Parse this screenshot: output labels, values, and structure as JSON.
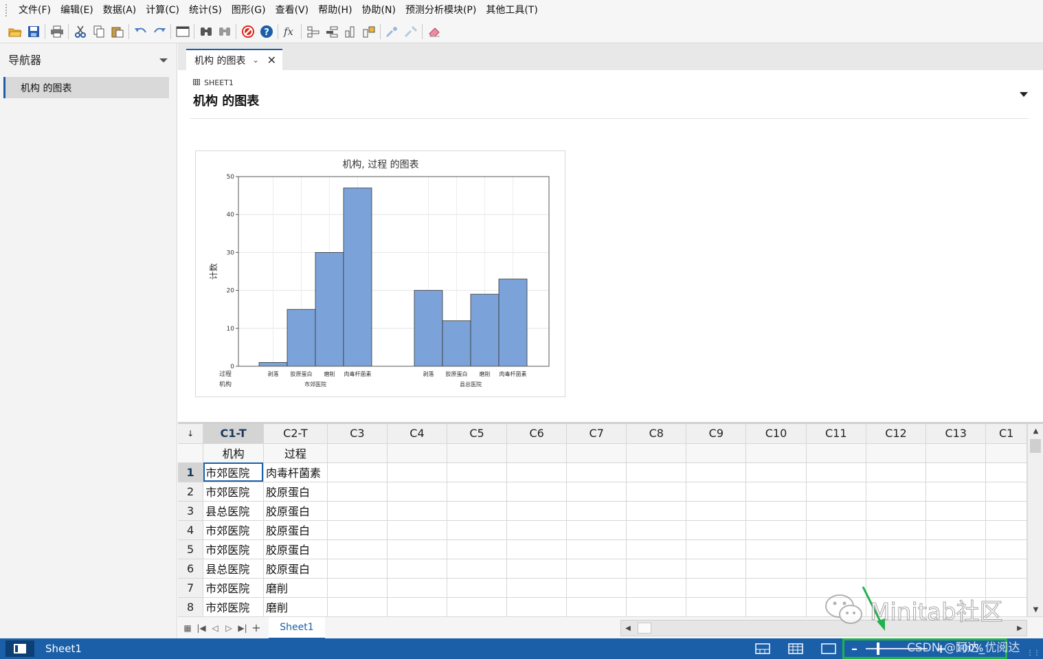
{
  "menubar": {
    "items": [
      "文件(F)",
      "编辑(E)",
      "数据(A)",
      "计算(C)",
      "统计(S)",
      "图形(G)",
      "查看(V)",
      "帮助(H)",
      "协助(N)",
      "预测分析模块(P)",
      "其他工具(T)"
    ]
  },
  "toolbar": {
    "icons": [
      "open-icon",
      "save-icon",
      "print-icon",
      "cut-icon",
      "copy-icon",
      "paste-icon",
      "undo-icon",
      "redo-icon",
      "window-icon",
      "find-icon",
      "find-replace-icon",
      "cancel-icon",
      "help-icon",
      "formula-icon",
      "row-insert-icon",
      "column-insert-icon",
      "cell-move-icon",
      "cell-arrange-icon",
      "brush-icon",
      "brush2-icon",
      "eraser-icon"
    ]
  },
  "navigator": {
    "title": "导航器",
    "items": [
      {
        "label": "机构 的图表"
      }
    ]
  },
  "tabs": [
    {
      "label": "机构 的图表"
    }
  ],
  "output": {
    "sheet_label": "SHEET1",
    "title": "机构 的图表"
  },
  "chart_data": {
    "type": "bar",
    "title": "机构, 过程 的图表",
    "ylabel": "计数",
    "ylim": [
      0,
      50
    ],
    "yticks": [
      0,
      10,
      20,
      30,
      40,
      50
    ],
    "row_labels": [
      "过程",
      "机构"
    ],
    "groups": [
      {
        "name": "市郊医院",
        "categories": [
          "剥落",
          "胶原蛋白",
          "磨削",
          "肉毒杆菌素"
        ],
        "values": [
          1,
          15,
          30,
          47
        ]
      },
      {
        "name": "县总医院",
        "categories": [
          "剥落",
          "胶原蛋白",
          "磨削",
          "肉毒杆菌素"
        ],
        "values": [
          20,
          12,
          19,
          23
        ]
      }
    ],
    "bar_color": "#7ba3d9",
    "grid": true
  },
  "worksheet": {
    "corner": "↓",
    "columns": [
      "C1-T",
      "C2-T",
      "C3",
      "C4",
      "C5",
      "C6",
      "C7",
      "C8",
      "C9",
      "C10",
      "C11",
      "C12",
      "C13",
      "C1"
    ],
    "names": [
      "机构",
      "过程",
      "",
      "",
      "",
      "",
      "",
      "",
      "",
      "",
      "",
      "",
      "",
      ""
    ],
    "rows": [
      {
        "num": "1",
        "c1": "市郊医院",
        "c2": "肉毒杆菌素"
      },
      {
        "num": "2",
        "c1": "市郊医院",
        "c2": "胶原蛋白"
      },
      {
        "num": "3",
        "c1": "县总医院",
        "c2": "胶原蛋白"
      },
      {
        "num": "4",
        "c1": "市郊医院",
        "c2": "胶原蛋白"
      },
      {
        "num": "5",
        "c1": "市郊医院",
        "c2": "胶原蛋白"
      },
      {
        "num": "6",
        "c1": "县总医院",
        "c2": "胶原蛋白"
      },
      {
        "num": "7",
        "c1": "市郊医院",
        "c2": "磨削"
      },
      {
        "num": "8",
        "c1": "市郊医院",
        "c2": "磨削"
      }
    ],
    "sheet_tab": "Sheet1"
  },
  "statusbar": {
    "sheet": "Sheet1",
    "zoom": "100%"
  },
  "watermark": {
    "text": "Minitab社区",
    "sub": "CSDN @阿达_优阅达"
  },
  "colors": {
    "accent": "#1a5fa8",
    "statusbar": "#1a5fa8",
    "highlight": "#22b24c"
  }
}
